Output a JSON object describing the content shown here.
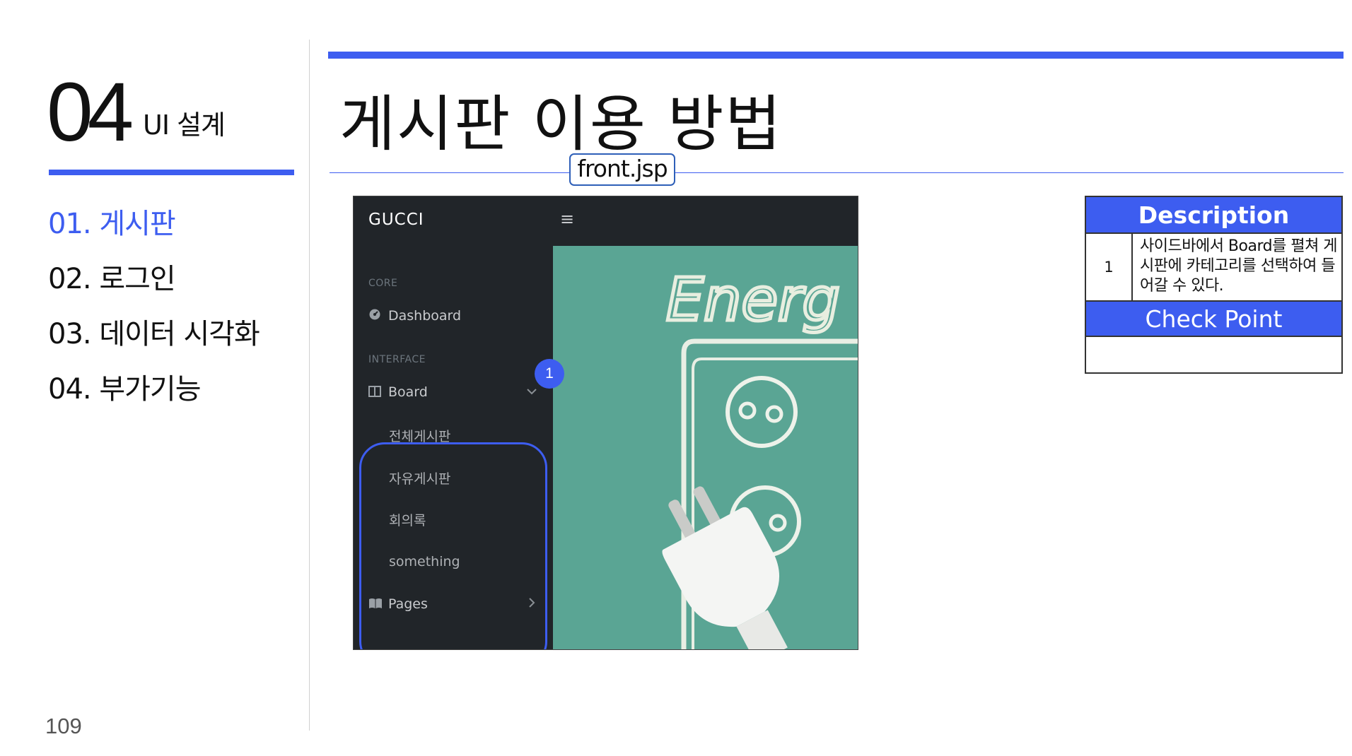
{
  "section": {
    "number": "04",
    "title": "UI 설계"
  },
  "nav": {
    "items": [
      {
        "label": "01. 게시판"
      },
      {
        "label": "02. 로그인"
      },
      {
        "label": "03. 데이터 시각화"
      },
      {
        "label": "04. 부가기능"
      }
    ]
  },
  "page_number": "109",
  "header": {
    "title": "게시판 이용 방법",
    "file_tag": "front.jsp"
  },
  "screenshot": {
    "brand": "GUCCI",
    "menu_icon": "≡",
    "sidebar": {
      "heading_core": "CORE",
      "dashboard": "Dashboard",
      "heading_interface": "INTERFACE",
      "board": "Board",
      "board_items": [
        "전체게시판",
        "자유게시판",
        "회의록",
        "something"
      ],
      "pages": "Pages"
    },
    "badge": "1",
    "photo_text": "Energ"
  },
  "description": {
    "header": "Description",
    "rows": [
      {
        "index": "1",
        "text": "사이드바에서 Board를 펼쳐 게시판에 카테고리를 선택하여 들어갈 수 있다."
      }
    ],
    "checkpoint_header": "Check Point",
    "checkpoint_body": ""
  },
  "colors": {
    "accent": "#3d5df0",
    "sidebar_bg": "#212529",
    "chalkboard": "#5aa594"
  }
}
